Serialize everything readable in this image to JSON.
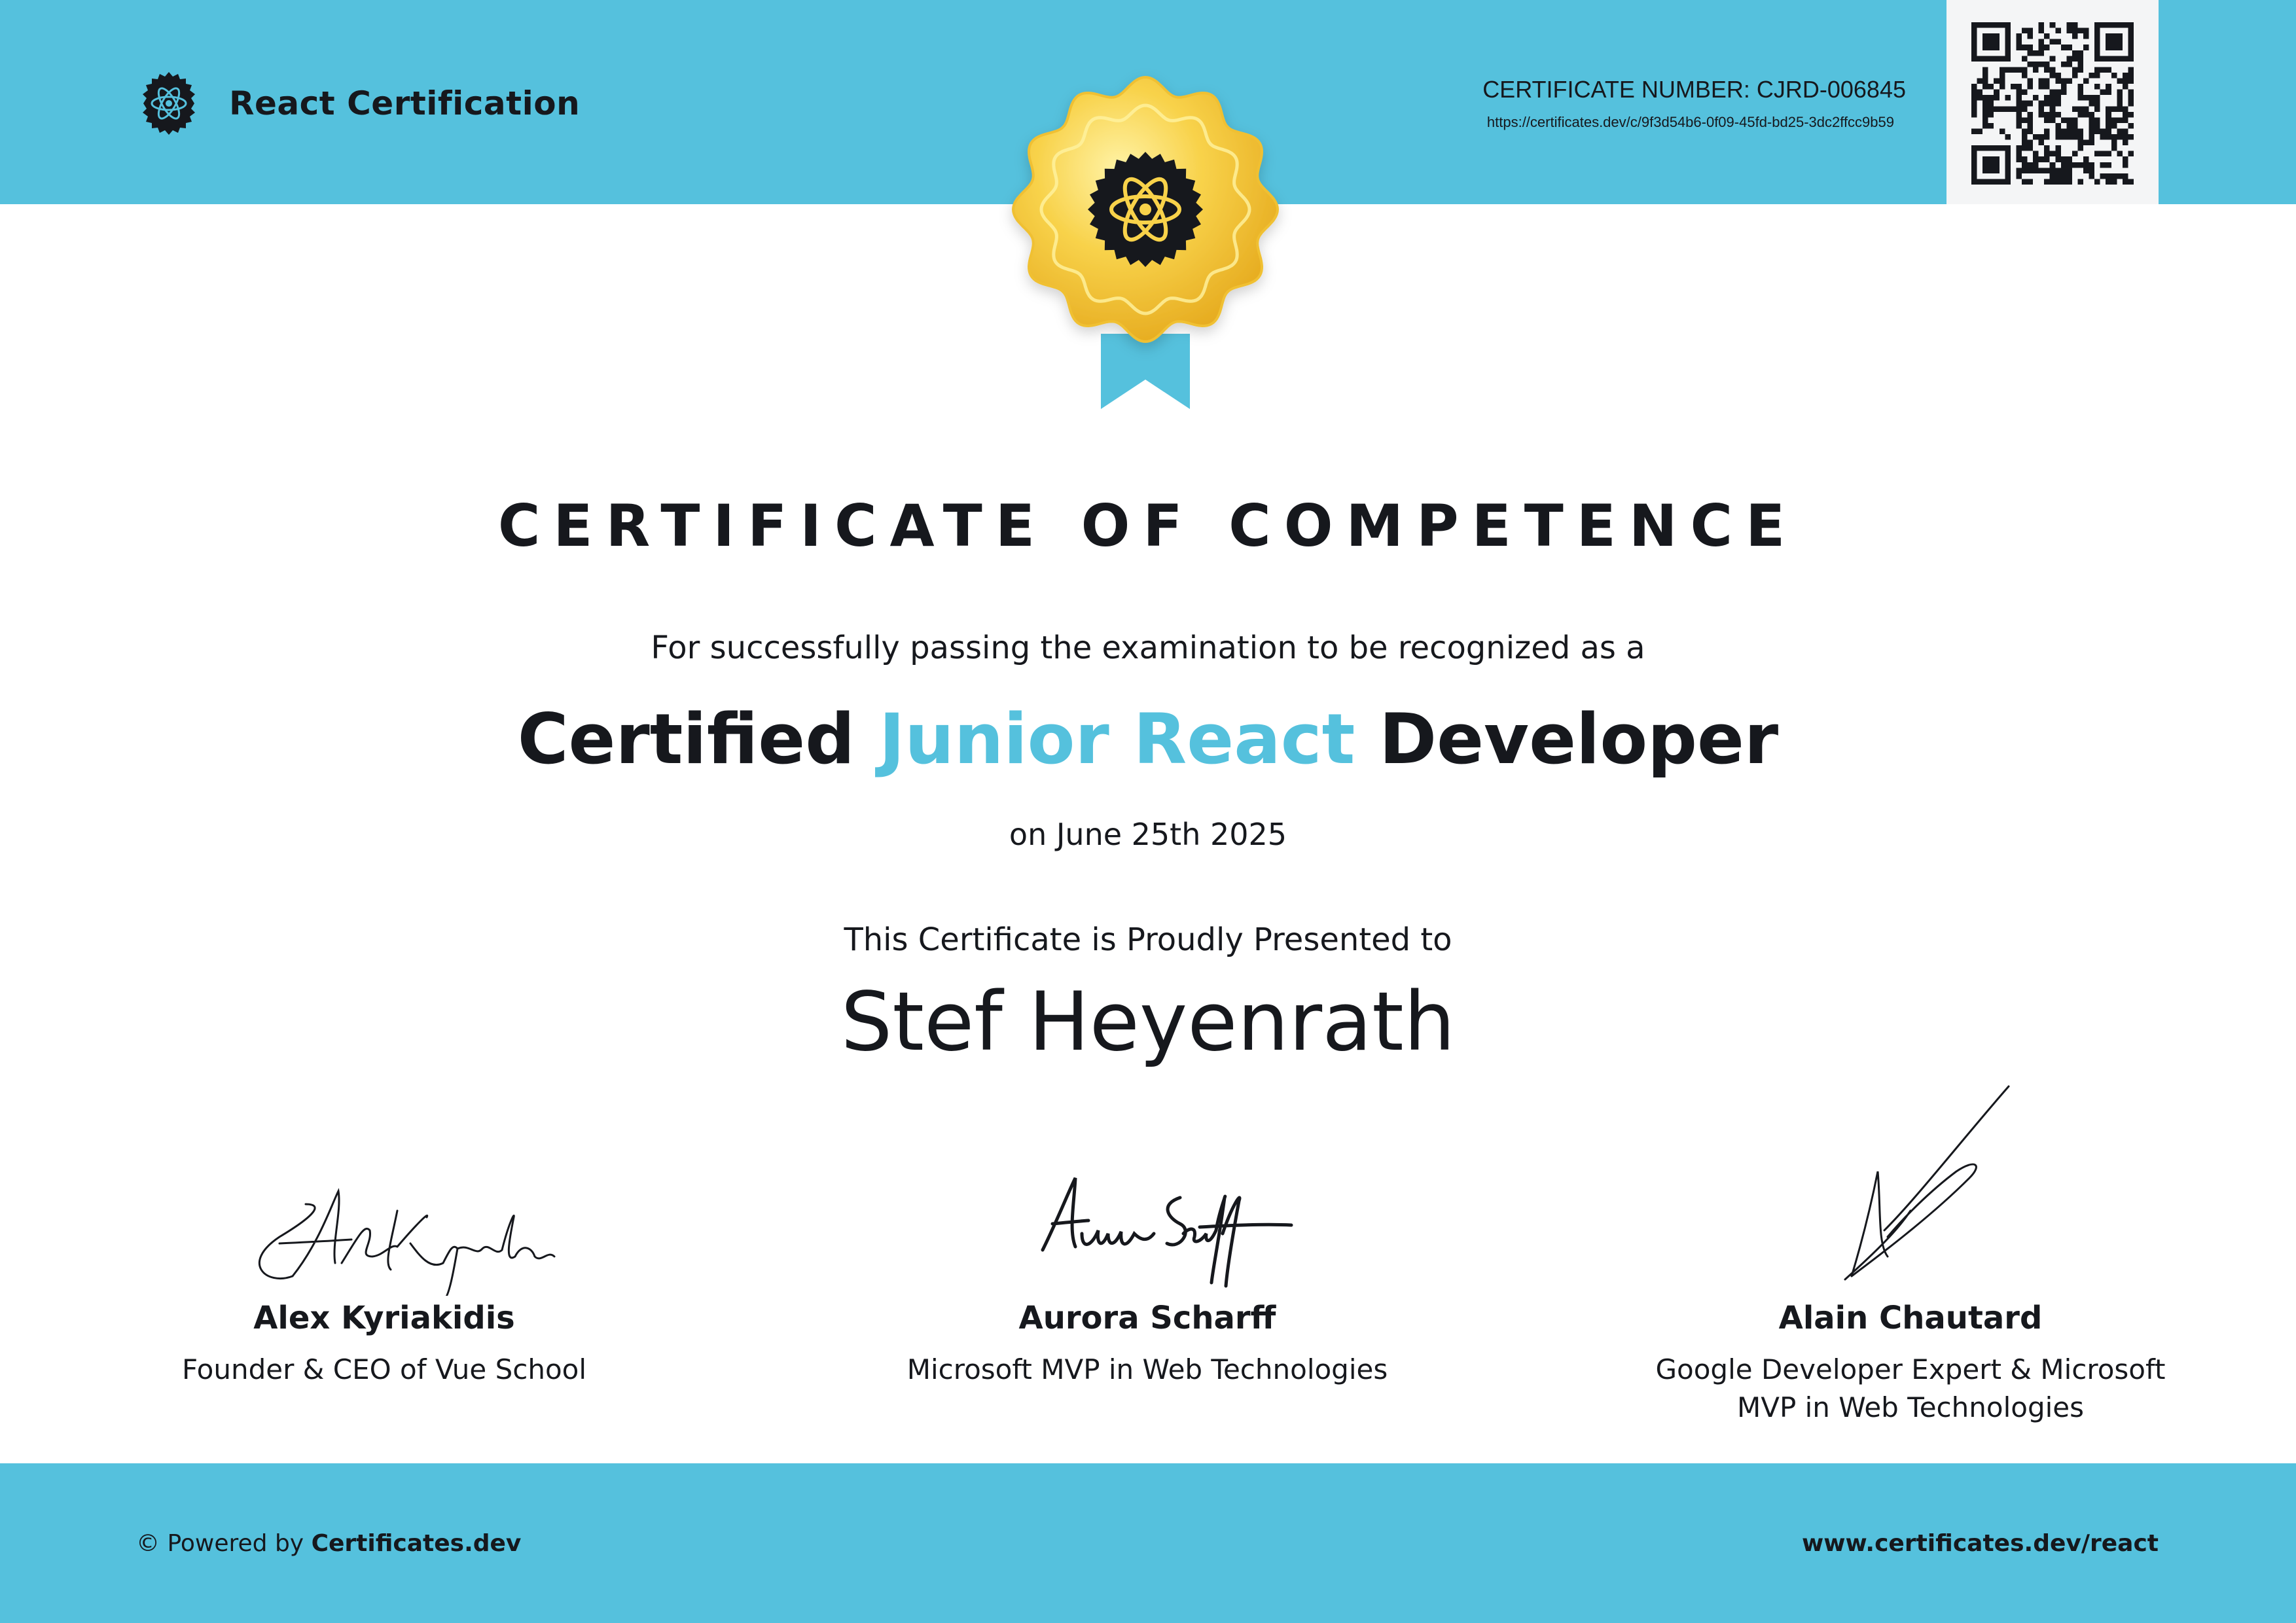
{
  "header": {
    "brand_name": "React Certification",
    "certificate_number": "CERTIFICATE NUMBER: CJRD-006845",
    "certificate_url": "https://certificates.dev/c/9f3d54b6-0f09-45fd-bd25-3dc2ffcc9b59"
  },
  "certificate": {
    "title": "CERTIFICATE OF COMPETENCE",
    "intro": "For successfully passing the examination to be recognized as a",
    "role_prefix": "Certified",
    "role_level": "Junior React",
    "role_suffix": "Developer",
    "date": "on June 25th 2025",
    "presented_text": "This Certificate is Proudly Presented to",
    "recipient": "Stef Heyenrath"
  },
  "signatories": [
    {
      "name": "Alex Kyriakidis",
      "role": "Founder & CEO of Vue School"
    },
    {
      "name": "Aurora Scharff",
      "role": "Microsoft MVP in Web Technologies"
    },
    {
      "name": "Alain Chautard",
      "role": "Google Developer Expert & Microsoft MVP in Web Technologies"
    }
  ],
  "footer": {
    "copyright_symbol": "©",
    "powered_by": "Powered by",
    "provider": "Certificates.dev",
    "website": "www.certificates.dev/react"
  },
  "icons": {
    "brand": "react-atom-icon",
    "medal": "gold-seal-medal-icon",
    "qr": "qr-code"
  },
  "colors": {
    "accent": "#55c1dd",
    "text": "#16181d",
    "gold": "#f5c53a",
    "qr_background": "#f4f5f6"
  }
}
